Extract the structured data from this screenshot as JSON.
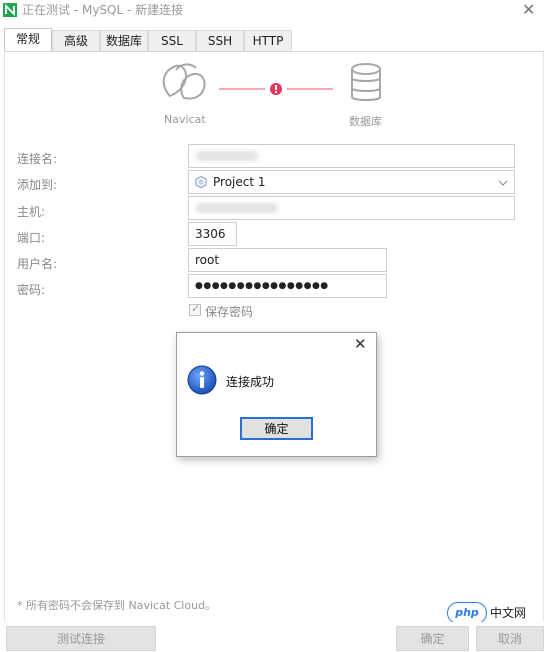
{
  "window": {
    "title": "正在测试 - MySQL - 新建连接",
    "close_glyph": "✕"
  },
  "tabs": [
    {
      "label": "常规",
      "active": true
    },
    {
      "label": "高级",
      "active": false
    },
    {
      "label": "数据库",
      "active": false
    },
    {
      "label": "SSL",
      "active": false
    },
    {
      "label": "SSH",
      "active": false
    },
    {
      "label": "HTTP",
      "active": false
    }
  ],
  "diagram": {
    "left_label": "Navicat",
    "right_label": "数据库",
    "status_color": "#e8375a",
    "line_color": "#f2a9b7"
  },
  "form": {
    "connection_name": {
      "label": "连接名:",
      "value": ""
    },
    "add_to": {
      "label": "添加到:",
      "value": "Project 1"
    },
    "host": {
      "label": "主机:",
      "value": ""
    },
    "port": {
      "label": "端口:",
      "value": "3306"
    },
    "username": {
      "label": "用户名:",
      "value": "root"
    },
    "password": {
      "label": "密码:",
      "value": "●●●●●●●●●●●●●●●●"
    },
    "save_password": {
      "label": "保存密码",
      "checked": true
    }
  },
  "footnote": "* 所有密码不会保存到 Navicat Cloud。",
  "buttons": {
    "test": "测试连接",
    "ok": "确定",
    "cancel": "取消"
  },
  "dialog": {
    "message": "连接成功",
    "ok": "确定",
    "close_glyph": "✕"
  },
  "watermark": {
    "badge": "php",
    "text": "中文网"
  }
}
